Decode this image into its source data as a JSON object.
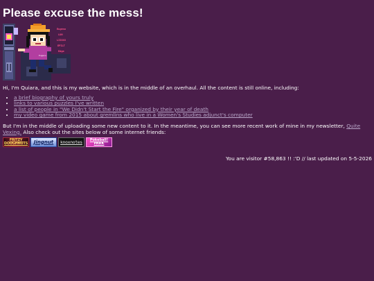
{
  "heading": "Please excuse the mess!",
  "intro": "Hi, I'm Quiara, and this is my website, which is in the middle of an overhaul. All the content is still online, including:",
  "links": [
    "a brief biography of yours truly",
    "links to various puzzles I've written",
    "a list of people in \"We Didn't Start the Fire\" organized by their year of death",
    "my video game from 2015 about gremlins who live in a Women's Studies adjunct's computer"
  ],
  "update": {
    "before": "But I'm in the middle of uploading some new content to it. In the meantime, you can see more recent work of mine in my newsletter, ",
    "link": "Quite Vexing.",
    "after": " Also check out the sites below of some internet friends:"
  },
  "buttons": [
    {
      "label": "FRITZY DOUGHNUTS"
    },
    {
      "label": "Jingnut"
    },
    {
      "label": "knoxnotes"
    },
    {
      "label": "Pokeball! PARK"
    }
  ],
  "visitor": {
    "prefix": "You are visitor ",
    "count": "#58,863",
    "suffix": " !! :'D // last updated on 5-5-2026"
  },
  "art": {
    "sign_lines": [
      "Eugeno",
      "LUN",
      "LIIXXX",
      "EPILT",
      "Edge"
    ],
    "screen_text": "Eugeno"
  },
  "colors": {
    "background": "#4a1e4a",
    "text": "#ffffff",
    "link": "#b9a7c9"
  }
}
